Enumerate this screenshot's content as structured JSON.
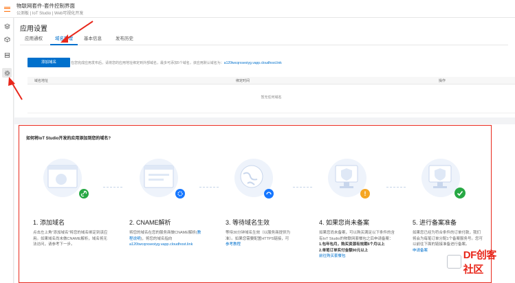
{
  "topbar": {
    "title": "物联网套件-套件控制界面",
    "crumb": "公测板 | IoT Studio | Web可视化开发"
  },
  "sidebar": {
    "items": [
      {
        "icon": "layers-icon"
      },
      {
        "icon": "cube-icon"
      },
      {
        "icon": "server-icon"
      },
      {
        "icon": "gear-icon"
      }
    ]
  },
  "page": {
    "title": "应用设置",
    "tabs": [
      {
        "label": "应用通权"
      },
      {
        "label": "域名管理"
      },
      {
        "label": "基本信息"
      },
      {
        "label": "发布历史"
      }
    ],
    "active_tab": "域名管理"
  },
  "domain": {
    "add_button": "添加域名",
    "hint_prefix": "在您完成应用发布后，请将您的应用地址绑定到外部域名，最多可添加5个域名，该应用默认域名为：",
    "default_domain": "a120twcqrxseoiyg.vapp.cloudhost.link",
    "columns": [
      "域名地址",
      "绑定时间",
      "操作"
    ],
    "empty_text": "暂无任何域名"
  },
  "guide": {
    "title": "如何将IoT Studio开发的应用添加到您的域名?",
    "steps": [
      {
        "title": "1. 添加域名",
        "desc": "点击左上角\"添加域名\"将您的域名绑定到该应用。如果域名尚未做CNAME解析，域名将无法访问，请参考下一步。",
        "link": "",
        "badge_color": "#27a844",
        "badge": "link"
      },
      {
        "title": "2. CNAME解析",
        "desc": "将您的域名在您的服务商做CNAME解析(",
        "desc_link": "教程说明",
        "desc_after": ")，将您的域名指向",
        "link": "a120twcqrxseoiyg.vapp.cloudhost.link",
        "badge_color": "#1677ff",
        "badge": "gear"
      },
      {
        "title": "3. 等待域名生效",
        "desc": "等待30分钟域名生效（以服务商提供为准）。如果您需要配置HTTPS链接，可",
        "link": "参考教程",
        "badge_color": "#1677ff",
        "badge": "loading"
      },
      {
        "title": "4. 如果您尚未备案",
        "desc": "如果您尚未备案，可以购买满足以下条件的含有IoT Studio的物联网套餐包之后申请备案：",
        "bold1": "1.包年包月，购买资源有效期6个月以上",
        "bold2": "2.单笔订单实付金额90元以上",
        "link": "前往购买套餐包",
        "badge_color": "#f5a623",
        "badge": "warning"
      },
      {
        "title": "5. 进行备案准备",
        "desc": "如果您已经为符合条件的订单付款，我们将会为每笔订单分配1个备案服务号。您可以前往下面的链接准备进行备案。",
        "link": "申请备案",
        "badge_color": "#27a844",
        "badge": "check"
      }
    ]
  },
  "watermark": {
    "text": "DF创客社区"
  },
  "colors": {
    "primary": "#0070cc",
    "accent": "#ff6a00",
    "annotation": "#e8271b"
  }
}
